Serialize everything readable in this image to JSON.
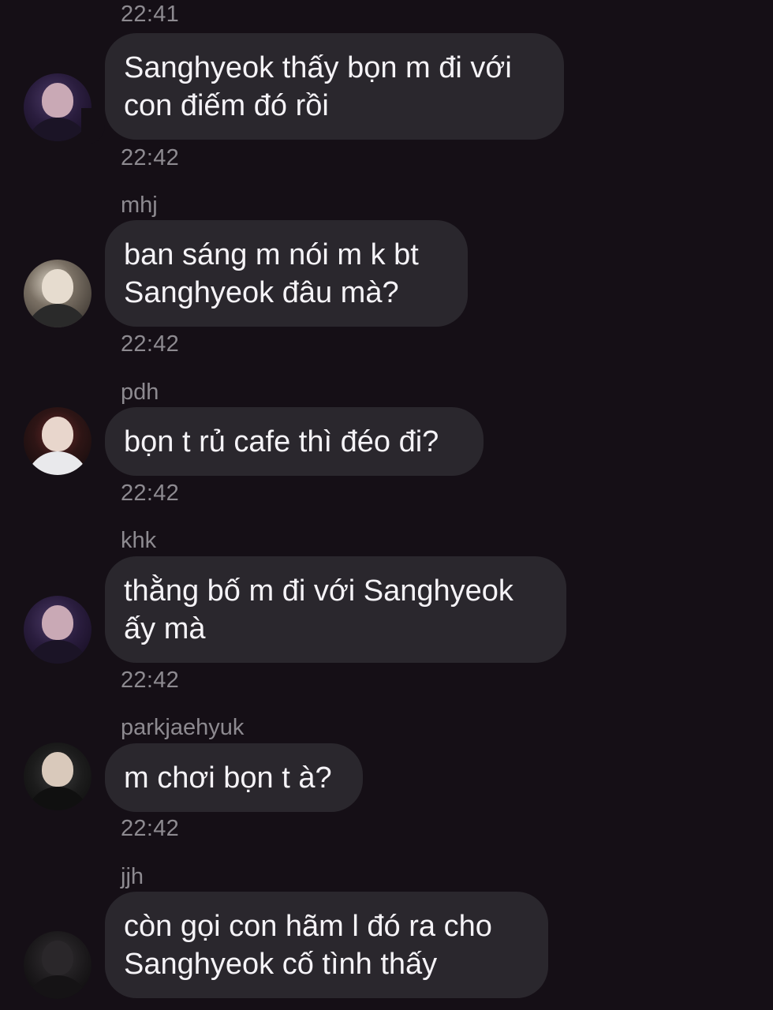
{
  "messages": [
    {
      "time_before": "22:41",
      "sender": "",
      "text_lines": [
        "Sanghyeok thấy bọn m đi với",
        "con điếm đó rồi"
      ]
    },
    {
      "time_before": "22:42",
      "sender": "mhj",
      "text_lines": [
        "ban sáng m nói m k bt",
        "Sanghyeok đâu mà?"
      ]
    },
    {
      "time_before": "22:42",
      "sender": "pdh",
      "text_lines": [
        "bọn t rủ cafe thì đéo đi?"
      ]
    },
    {
      "time_before": "22:42",
      "sender": "khk",
      "text_lines": [
        "thằng bố m đi với Sanghyeok",
        "ấy mà"
      ]
    },
    {
      "time_before": "22:42",
      "sender": "parkjaehyuk",
      "text_lines": [
        "m chơi bọn t à?"
      ]
    },
    {
      "time_before": "22:42",
      "sender": "jjh",
      "text_lines": [
        "còn gọi con hãm l đó ra cho",
        "Sanghyeok cố tình thấy"
      ]
    }
  ],
  "colors": {
    "background": "#150f16",
    "bubble": "#2a272d",
    "meta_text": "#8d8a90",
    "message_text": "#f5f3f7"
  }
}
